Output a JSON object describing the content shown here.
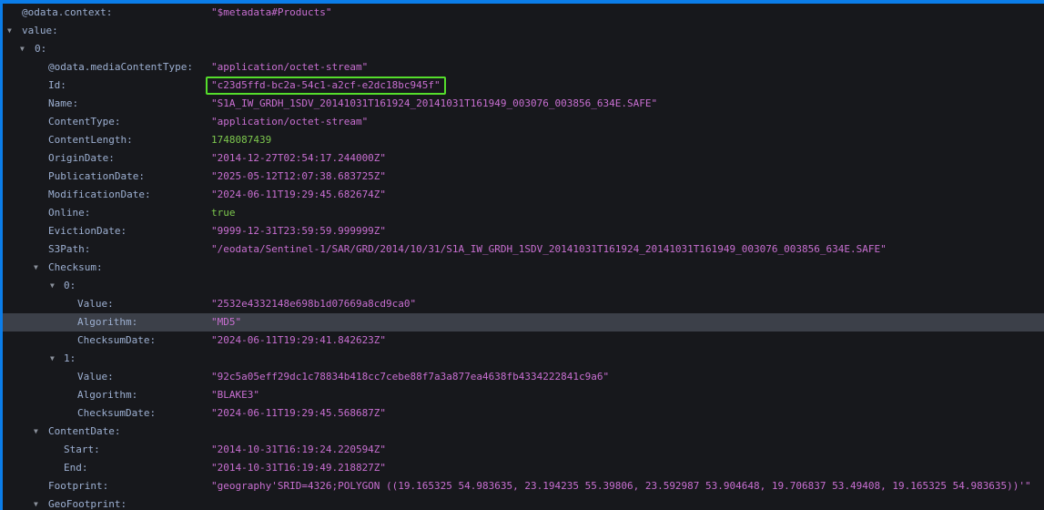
{
  "theme": {
    "background": "#17181c",
    "window_border_color": "#0b7de9",
    "key_color": "#9db0d2",
    "string_color": "#c86fd1",
    "number_color": "#7dc84e",
    "boolean_color": "#7dc84e",
    "expander_color": "#8b919c",
    "selected_row_background": "#3c4049",
    "id_highlight_border_color": "#55dd2c"
  },
  "json_tree": {
    "rows": [
      {
        "depth": 0,
        "key": "@odata.context",
        "value": "$metadata#Products",
        "type": "string",
        "expandable": false
      },
      {
        "depth": 0,
        "key": "value",
        "type": "object",
        "expandable": true
      },
      {
        "depth": 1,
        "key": "0",
        "type": "object",
        "expandable": true
      },
      {
        "depth": 2,
        "key": "@odata.mediaContentType",
        "value": "application/octet-stream",
        "type": "string",
        "expandable": false
      },
      {
        "depth": 2,
        "key": "Id",
        "value": "c23d5ffd-bc2a-54c1-a2cf-e2dc18bc945f",
        "type": "string",
        "expandable": false,
        "boxed": true
      },
      {
        "depth": 2,
        "key": "Name",
        "value": "S1A_IW_GRDH_1SDV_20141031T161924_20141031T161949_003076_003856_634E.SAFE",
        "type": "string",
        "expandable": false
      },
      {
        "depth": 2,
        "key": "ContentType",
        "value": "application/octet-stream",
        "type": "string",
        "expandable": false
      },
      {
        "depth": 2,
        "key": "ContentLength",
        "value": 1748087439,
        "type": "number",
        "expandable": false
      },
      {
        "depth": 2,
        "key": "OriginDate",
        "value": "2014-12-27T02:54:17.244000Z",
        "type": "string",
        "expandable": false
      },
      {
        "depth": 2,
        "key": "PublicationDate",
        "value": "2025-05-12T12:07:38.683725Z",
        "type": "string",
        "expandable": false
      },
      {
        "depth": 2,
        "key": "ModificationDate",
        "value": "2024-06-11T19:29:45.682674Z",
        "type": "string",
        "expandable": false
      },
      {
        "depth": 2,
        "key": "Online",
        "value": true,
        "type": "boolean",
        "expandable": false
      },
      {
        "depth": 2,
        "key": "EvictionDate",
        "value": "9999-12-31T23:59:59.999999Z",
        "type": "string",
        "expandable": false
      },
      {
        "depth": 2,
        "key": "S3Path",
        "value": "/eodata/Sentinel-1/SAR/GRD/2014/10/31/S1A_IW_GRDH_1SDV_20141031T161924_20141031T161949_003076_003856_634E.SAFE",
        "type": "string",
        "expandable": false
      },
      {
        "depth": 2,
        "key": "Checksum",
        "type": "array",
        "expandable": true
      },
      {
        "depth": 3,
        "key": "0",
        "type": "object",
        "expandable": true
      },
      {
        "depth": 4,
        "key": "Value",
        "value": "2532e4332148e698b1d07669a8cd9ca0",
        "type": "string",
        "expandable": false
      },
      {
        "depth": 4,
        "key": "Algorithm",
        "value": "MD5",
        "type": "string",
        "expandable": false,
        "selected": true
      },
      {
        "depth": 4,
        "key": "ChecksumDate",
        "value": "2024-06-11T19:29:41.842623Z",
        "type": "string",
        "expandable": false
      },
      {
        "depth": 3,
        "key": "1",
        "type": "object",
        "expandable": true
      },
      {
        "depth": 4,
        "key": "Value",
        "value": "92c5a05eff29dc1c78834b418cc7cebe88f7a3a877ea4638fb4334222841c9a6",
        "type": "string",
        "expandable": false
      },
      {
        "depth": 4,
        "key": "Algorithm",
        "value": "BLAKE3",
        "type": "string",
        "expandable": false
      },
      {
        "depth": 4,
        "key": "ChecksumDate",
        "value": "2024-06-11T19:29:45.568687Z",
        "type": "string",
        "expandable": false
      },
      {
        "depth": 2,
        "key": "ContentDate",
        "type": "object",
        "expandable": true
      },
      {
        "depth": 3,
        "key": "Start",
        "value": "2014-10-31T16:19:24.220594Z",
        "type": "string",
        "expandable": false
      },
      {
        "depth": 3,
        "key": "End",
        "value": "2014-10-31T16:19:49.218827Z",
        "type": "string",
        "expandable": false
      },
      {
        "depth": 2,
        "key": "Footprint",
        "value": "geography'SRID=4326;POLYGON ((19.165325 54.983635, 23.194235 55.39806, 23.592987 53.904648, 19.706837 53.49408, 19.165325 54.983635))'",
        "type": "string",
        "expandable": false
      },
      {
        "depth": 2,
        "key": "GeoFootprint",
        "type": "object",
        "expandable": true
      }
    ],
    "expander_glyph": "▼"
  }
}
